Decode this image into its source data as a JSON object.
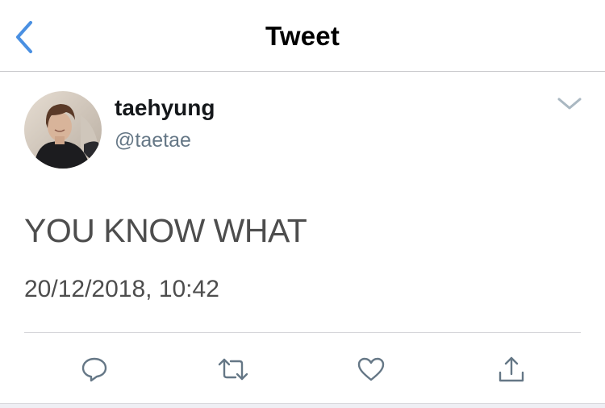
{
  "nav": {
    "title": "Tweet",
    "back_icon": "chevron-left-icon"
  },
  "tweet": {
    "author": {
      "display_name": "taehyung",
      "handle": "@taetae"
    },
    "text": "YOU KNOW WHAT",
    "timestamp": "20/12/2018, 10:42",
    "menu_icon": "chevron-down-icon"
  },
  "actions": [
    {
      "name": "reply",
      "icon": "reply-icon"
    },
    {
      "name": "retweet",
      "icon": "retweet-icon"
    },
    {
      "name": "like",
      "icon": "heart-icon"
    },
    {
      "name": "share",
      "icon": "share-icon"
    }
  ],
  "colors": {
    "accent": "#4a90e2",
    "text_primary": "#14171a",
    "text_secondary": "#657786",
    "icon_gray": "#657786"
  }
}
